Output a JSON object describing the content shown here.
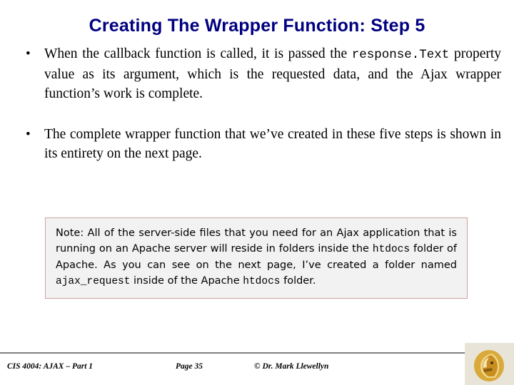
{
  "slide": {
    "title": "Creating The Wrapper Function: Step 5",
    "bullets": [
      {
        "marker": "•",
        "segments": [
          {
            "type": "text",
            "value": "When the callback function is called, it is passed the "
          },
          {
            "type": "mono",
            "value": "response.Text"
          },
          {
            "type": "text",
            "value": " property value as its argument, which is the requested data, and the Ajax wrapper function’s work is complete."
          }
        ]
      },
      {
        "marker": "•",
        "segments": [
          {
            "type": "text",
            "value": "The complete wrapper function that we’ve created in these five steps is shown in its entirety on the next page."
          }
        ]
      }
    ],
    "note": {
      "segments": [
        {
          "type": "text",
          "value": "Note:  All of the server-side files that you need for an Ajax application that is running on an Apache server will reside in folders inside the "
        },
        {
          "type": "mono",
          "value": "htdocs"
        },
        {
          "type": "text",
          "value": " folder of Apache.  As you can see on the next page, I’ve created a folder named "
        },
        {
          "type": "mono",
          "value": "ajax_request"
        },
        {
          "type": "text",
          "value": " inside of the Apache "
        },
        {
          "type": "mono",
          "value": "htdocs"
        },
        {
          "type": "text",
          "value": " folder."
        }
      ],
      "background_color": "#f2f2f2",
      "border_color": "#d0a0a0"
    },
    "footer": {
      "left": "CIS 4004: AJAX – Part 1",
      "center": "Page 35",
      "right": "© Dr. Mark Llewellyn"
    },
    "title_color": "#000080",
    "logo_name": "ucf-knight-logo"
  }
}
